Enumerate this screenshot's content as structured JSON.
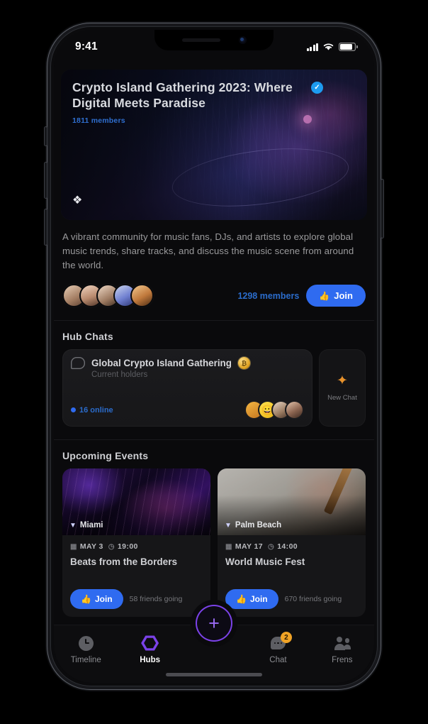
{
  "status_bar": {
    "time": "9:41",
    "signal_icon": "cellular-bars-icon",
    "wifi_icon": "wifi-icon",
    "battery_icon": "battery-icon"
  },
  "hero": {
    "title": "Crypto Island Gathering 2023: Where Digital Meets Paradise",
    "verified_icon": "verified-check-icon",
    "members": "1811 members",
    "expand_icon": "expand-icon"
  },
  "description": "A vibrant community for music fans, DJs, and artists to explore global music trends, share tracks, and discuss the music scene from around the world.",
  "members_row": {
    "count_label": "1298 members",
    "join_label": "Join",
    "join_icon": "thumbs-up-icon",
    "avatars": [
      "avatar-1",
      "avatar-2",
      "avatar-3",
      "avatar-4",
      "avatar-5"
    ]
  },
  "hub_chats": {
    "section_title": "Hub Chats",
    "chat": {
      "icon": "chat-bubble-icon",
      "name": "Global Crypto Island Gathering",
      "badge": "coin-badge",
      "badge_text": "₿",
      "subtitle": "Current holders",
      "online_label": "16 online",
      "avatars": [
        "chat-avatar-1",
        "chat-avatar-2",
        "chat-avatar-3",
        "chat-avatar-4"
      ]
    },
    "new_chat": {
      "icon": "sparkle-icon",
      "label": "New Chat"
    }
  },
  "upcoming_events": {
    "section_title": "Upcoming Events",
    "events": [
      {
        "location": "Miami",
        "location_icon": "location-pin-icon",
        "date": "MAY 3",
        "date_icon": "calendar-icon",
        "time": "19:00",
        "time_icon": "clock-icon",
        "title": "Beats from the Borders",
        "join_label": "Join",
        "join_icon": "thumbs-up-icon",
        "friends": "58 friends going"
      },
      {
        "location": "Palm Beach",
        "location_icon": "location-pin-icon",
        "date": "MAY 17",
        "date_icon": "calendar-icon",
        "time": "14:00",
        "time_icon": "clock-icon",
        "title": "World Music Fest",
        "join_label": "Join",
        "join_icon": "thumbs-up-icon",
        "friends": "670 friends going"
      }
    ]
  },
  "tab_bar": {
    "tabs": [
      {
        "label": "Timeline",
        "icon": "clock-icon",
        "active": false
      },
      {
        "label": "Hubs",
        "icon": "hexagon-icon",
        "active": true
      },
      {
        "label": "Chat",
        "icon": "chat-bubble-icon",
        "active": false,
        "badge": "2"
      },
      {
        "label": "Frens",
        "icon": "people-icon",
        "active": false
      }
    ],
    "fab": {
      "icon": "plus-icon",
      "label": "+"
    }
  },
  "colors": {
    "accent_purple": "#7b42e8",
    "accent_blue": "#2f6bf0",
    "badge_orange": "#f0a326",
    "gold": "#e0a320",
    "background": "#0a0a0c"
  }
}
